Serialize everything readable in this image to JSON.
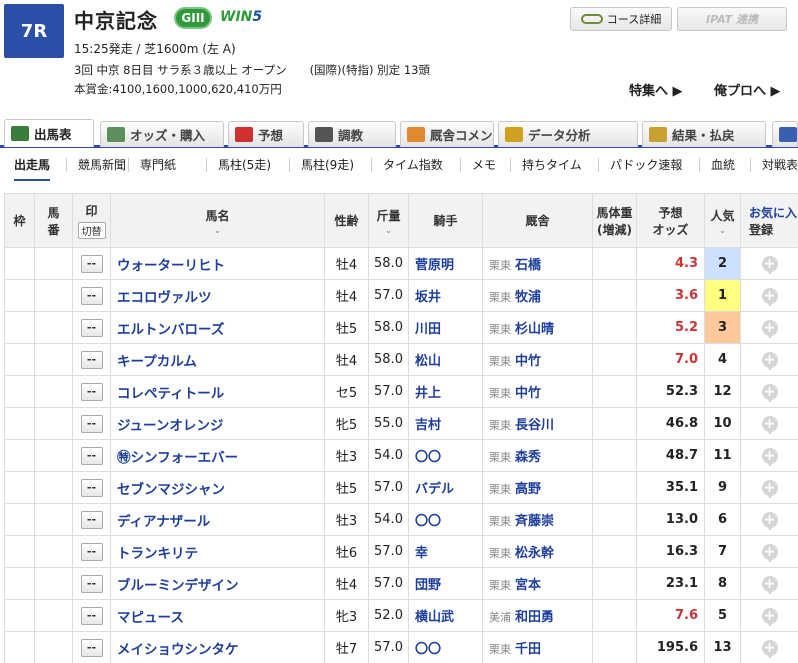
{
  "race": {
    "number": "7R",
    "name": "中京記念",
    "grade": "GIII",
    "win5_a": "WIN",
    "win5_b": "5",
    "info1": "15:25発走 / 芝1600m (左 A)",
    "info2": "3回 中京 8日目 サラ系３歳以上 オープン　　(国際)(特指) 別定 13頭",
    "info3": "本賞金:4100,1600,1000,620,410万円"
  },
  "buttons": {
    "course": "コース詳細",
    "ipat": "IPAT 連携"
  },
  "links": {
    "feature": "特集へ ▶",
    "pro": "俺プロへ ▶"
  },
  "tabs": [
    {
      "label": "出馬表",
      "color": "#3a7d3a"
    },
    {
      "label": "オッズ・購入",
      "color": "#5c8f5c"
    },
    {
      "label": "予想",
      "color": "#d03030"
    },
    {
      "label": "調教",
      "color": "#555555"
    },
    {
      "label": "厩舎コメント",
      "color": "#e08a30"
    },
    {
      "label": "データ分析",
      "color": "#d0a020"
    },
    {
      "label": "結果・払戻",
      "color": "#c8a030"
    },
    {
      "label": "",
      "color": "#3a5fb0"
    }
  ],
  "subtabs": [
    "出走馬",
    "競馬新聞",
    "専門紙",
    "馬柱(5走)",
    "馬柱(9走)",
    "タイム指数",
    "メモ",
    "持ちタイム",
    "パドック速報",
    "血統",
    "対戦表"
  ],
  "header": {
    "waku": "枠",
    "umaban1": "馬",
    "umaban2": "番",
    "mark": "印",
    "mark_toggle": "切替",
    "horse": "馬名",
    "sexage": "性齢",
    "weight": "斤量",
    "jockey": "騎手",
    "stable": "厩舎",
    "bw1": "馬体重",
    "bw2": "(増減)",
    "odds1": "予想",
    "odds2": "オッズ",
    "pop": "人気",
    "fav1": "お気に入",
    "fav2": "登録",
    "sort": "⌄"
  },
  "rows": [
    {
      "mark": "--",
      "horse": "ウォーターリヒト",
      "sexage": "牡4",
      "weight": "58.0",
      "jockey": "菅原明",
      "area": "栗東",
      "trainer": "石橋",
      "odds": "4.3",
      "pop": "2"
    },
    {
      "mark": "--",
      "horse": "エコロヴァルツ",
      "sexage": "牡4",
      "weight": "57.0",
      "jockey": "坂井",
      "area": "栗東",
      "trainer": "牧浦",
      "odds": "3.6",
      "pop": "1"
    },
    {
      "mark": "--",
      "horse": "エルトンバローズ",
      "sexage": "牡5",
      "weight": "58.0",
      "jockey": "川田",
      "area": "栗東",
      "trainer": "杉山晴",
      "odds": "5.2",
      "pop": "3"
    },
    {
      "mark": "--",
      "horse": "キープカルム",
      "sexage": "牡4",
      "weight": "58.0",
      "jockey": "松山",
      "area": "栗東",
      "trainer": "中竹",
      "odds": "7.0",
      "pop": "4"
    },
    {
      "mark": "--",
      "horse": "コレペティトール",
      "sexage": "セ5",
      "weight": "57.0",
      "jockey": "井上",
      "area": "栗東",
      "trainer": "中竹",
      "odds": "52.3",
      "pop": "12"
    },
    {
      "mark": "--",
      "horse": "ジューンオレンジ",
      "sexage": "牝5",
      "weight": "55.0",
      "jockey": "吉村",
      "area": "栗東",
      "trainer": "長谷川",
      "odds": "46.8",
      "pop": "10"
    },
    {
      "mark": "--",
      "horse": "㊕シンフォーエバー",
      "sexage": "牡3",
      "weight": "54.0",
      "jockey": "〇〇",
      "area": "栗東",
      "trainer": "森秀",
      "odds": "48.7",
      "pop": "11"
    },
    {
      "mark": "--",
      "horse": "セブンマジシャン",
      "sexage": "牡5",
      "weight": "57.0",
      "jockey": "バデル",
      "area": "栗東",
      "trainer": "高野",
      "odds": "35.1",
      "pop": "9"
    },
    {
      "mark": "--",
      "horse": "ディアナザール",
      "sexage": "牡3",
      "weight": "54.0",
      "jockey": "〇〇",
      "area": "栗東",
      "trainer": "斉藤崇",
      "odds": "13.0",
      "pop": "6"
    },
    {
      "mark": "--",
      "horse": "トランキリテ",
      "sexage": "牡6",
      "weight": "57.0",
      "jockey": "幸",
      "area": "栗東",
      "trainer": "松永幹",
      "odds": "16.3",
      "pop": "7"
    },
    {
      "mark": "--",
      "horse": "ブルーミンデザイン",
      "sexage": "牡4",
      "weight": "57.0",
      "jockey": "団野",
      "area": "栗東",
      "trainer": "宮本",
      "odds": "23.1",
      "pop": "8"
    },
    {
      "mark": "--",
      "horse": "マピュース",
      "sexage": "牝3",
      "weight": "52.0",
      "jockey": "横山武",
      "area": "美浦",
      "trainer": "和田勇",
      "odds": "7.6",
      "pop": "5"
    },
    {
      "mark": "--",
      "horse": "メイショウシンタケ",
      "sexage": "牡7",
      "weight": "57.0",
      "jockey": "〇〇",
      "area": "栗東",
      "trainer": "千田",
      "odds": "195.6",
      "pop": "13"
    }
  ],
  "register_icon": "+"
}
